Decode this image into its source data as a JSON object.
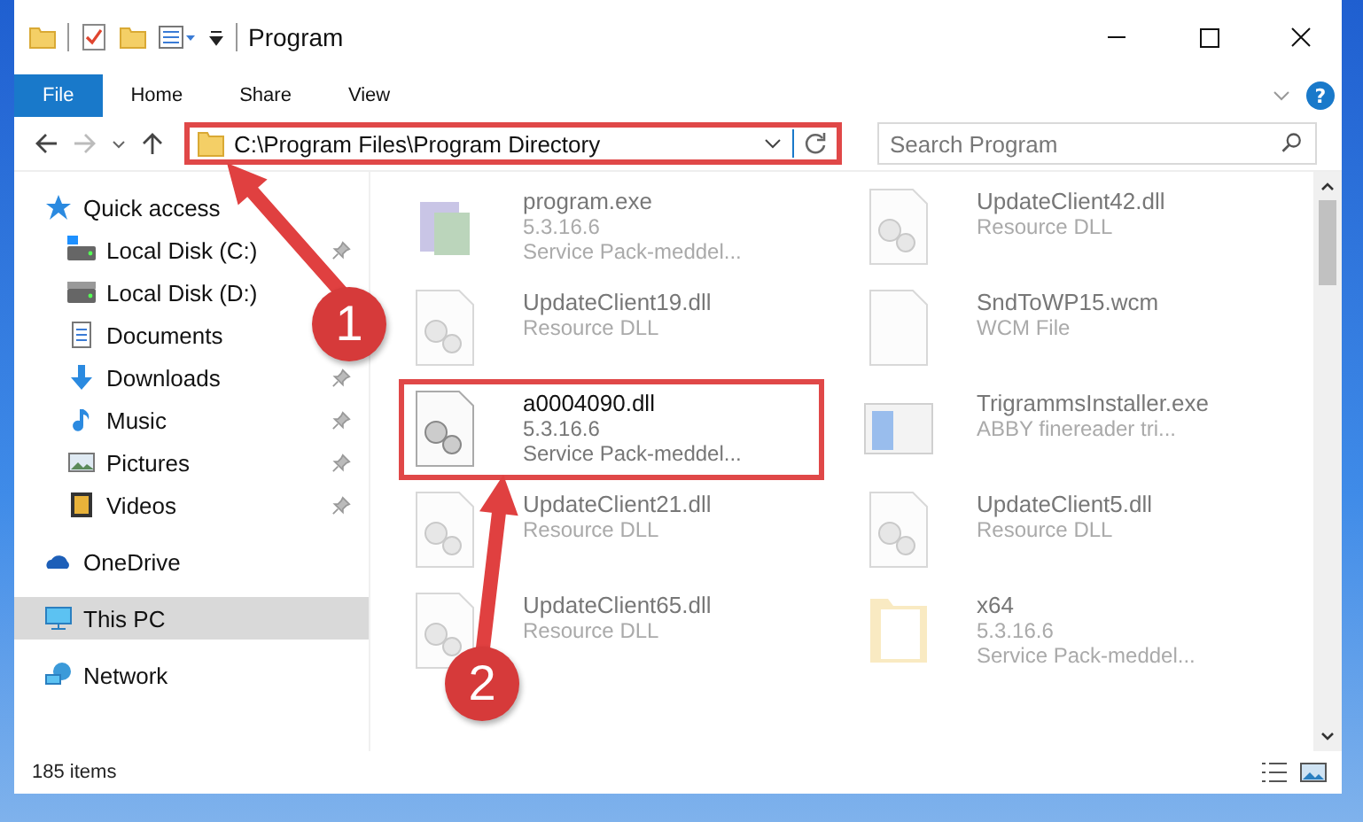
{
  "window": {
    "title": "Program"
  },
  "ribbon": {
    "tabs": [
      {
        "label": "File",
        "selected": true
      },
      {
        "label": "Home",
        "selected": false
      },
      {
        "label": "Share",
        "selected": false
      },
      {
        "label": "View",
        "selected": false
      }
    ],
    "help": "?"
  },
  "address": {
    "path": "C:\\Program Files\\Program Directory",
    "highlighted": true
  },
  "search": {
    "placeholder": "Search Program"
  },
  "sidebar": {
    "items": [
      {
        "label": "Quick access",
        "kind": "star",
        "selected": false,
        "children": [
          {
            "label": "Local Disk (C:)",
            "kind": "disk-c",
            "pinned": true,
            "selected": false
          },
          {
            "label": "Local Disk (D:)",
            "kind": "disk",
            "pinned": false,
            "selected": false
          },
          {
            "label": "Documents",
            "kind": "documents",
            "pinned": false,
            "selected": false
          },
          {
            "label": "Downloads",
            "kind": "downloads",
            "pinned": true,
            "selected": false
          },
          {
            "label": "Music",
            "kind": "music",
            "pinned": true,
            "selected": false
          },
          {
            "label": "Pictures",
            "kind": "pictures",
            "pinned": true,
            "selected": false
          },
          {
            "label": "Videos",
            "kind": "videos",
            "pinned": true,
            "selected": false
          }
        ]
      },
      {
        "label": "OneDrive",
        "kind": "cloud",
        "selected": false
      },
      {
        "label": "This PC",
        "kind": "pc",
        "selected": true
      },
      {
        "label": "Network",
        "kind": "network",
        "selected": false
      }
    ]
  },
  "files": [
    {
      "name": "program.exe",
      "lines": [
        "5.3.16.6",
        "Service Pack-meddel..."
      ],
      "kind": "exe",
      "blurred": true,
      "highlighted": false
    },
    {
      "name": "UpdateClient42.dll",
      "lines": [
        "Resource DLL"
      ],
      "kind": "dll",
      "blurred": true,
      "highlighted": false
    },
    {
      "name": "UpdateClient19.dll",
      "lines": [
        "Resource DLL"
      ],
      "kind": "dll",
      "blurred": true,
      "highlighted": false
    },
    {
      "name": "SndToWP15.wcm",
      "lines": [
        "WCM File"
      ],
      "kind": "blank",
      "blurred": true,
      "highlighted": false
    },
    {
      "name": "a0004090.dll",
      "lines": [
        "5.3.16.6",
        "Service Pack-meddel..."
      ],
      "kind": "dll",
      "blurred": false,
      "highlighted": true
    },
    {
      "name": "TrigrammsInstaller.exe",
      "lines": [
        "ABBY finereader tri..."
      ],
      "kind": "installer",
      "blurred": true,
      "highlighted": false
    },
    {
      "name": "UpdateClient21.dll",
      "lines": [
        "Resource DLL"
      ],
      "kind": "dll",
      "blurred": true,
      "highlighted": false
    },
    {
      "name": "UpdateClient5.dll",
      "lines": [
        "Resource DLL"
      ],
      "kind": "dll",
      "blurred": true,
      "highlighted": false
    },
    {
      "name": "UpdateClient65.dll",
      "lines": [
        "Resource DLL"
      ],
      "kind": "dll",
      "blurred": true,
      "highlighted": false
    },
    {
      "name": "x64",
      "lines": [
        "5.3.16.6",
        "Service Pack-meddel..."
      ],
      "kind": "folder",
      "blurred": true,
      "highlighted": false
    }
  ],
  "status_bar": {
    "count": "185 items"
  },
  "annotations": [
    {
      "number": "1"
    },
    {
      "number": "2"
    }
  ]
}
